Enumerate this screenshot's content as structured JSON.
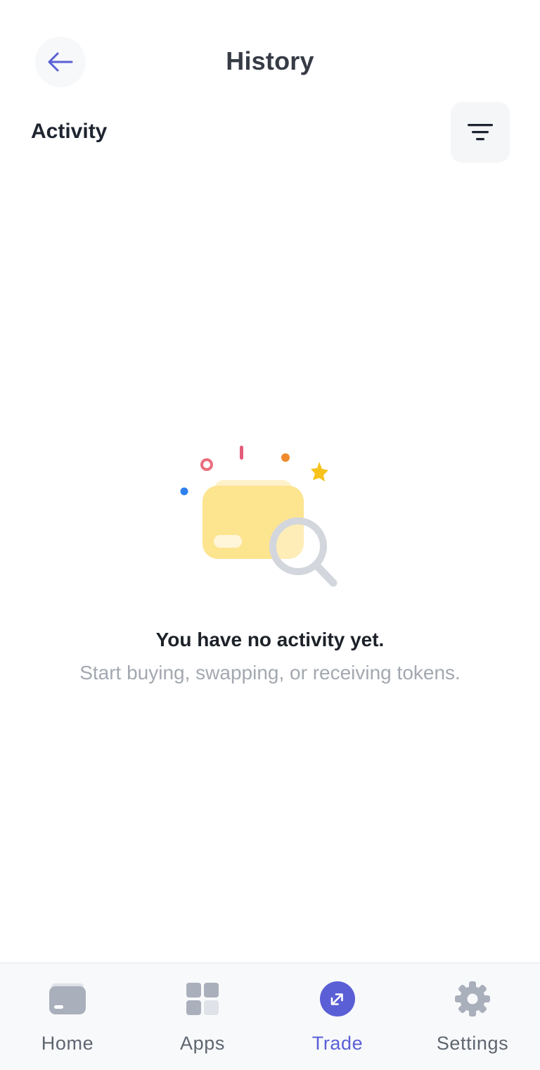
{
  "header": {
    "title": "History",
    "back_icon": "arrow-left-icon"
  },
  "section": {
    "title": "Activity",
    "filter_icon": "filter-icon"
  },
  "empty_state": {
    "illustration": "wallet-search-illustration",
    "title": "You have no activity yet.",
    "subtitle": "Start buying, swapping, or receiving tokens."
  },
  "bottom_nav": {
    "items": [
      {
        "label": "Home",
        "icon": "wallet-icon",
        "active": false
      },
      {
        "label": "Apps",
        "icon": "apps-grid-icon",
        "active": false
      },
      {
        "label": "Trade",
        "icon": "trade-arrows-icon",
        "active": true
      },
      {
        "label": "Settings",
        "icon": "gear-icon",
        "active": false
      }
    ]
  },
  "colors": {
    "accent": "#5a5fd6",
    "text_primary": "#1f2530",
    "text_secondary": "#a3a8b0",
    "nav_inactive": "#a9afbb"
  }
}
